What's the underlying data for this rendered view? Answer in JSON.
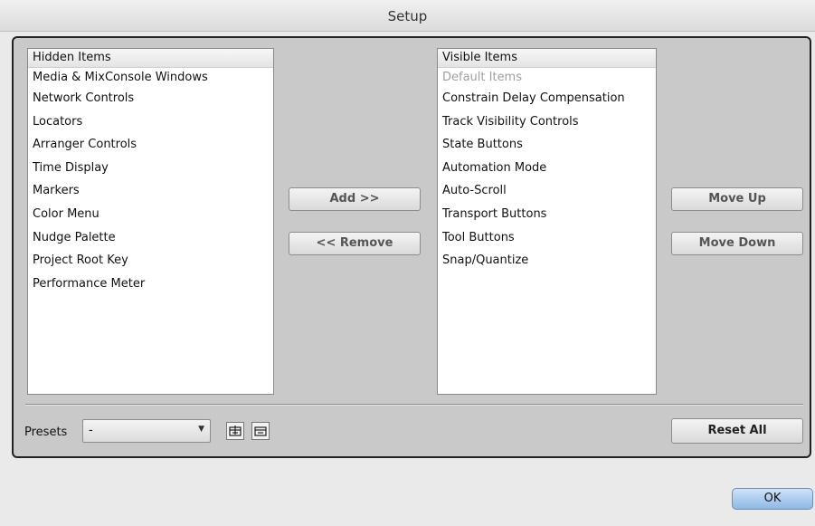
{
  "window": {
    "title": "Setup"
  },
  "hidden_list": {
    "header": "Hidden Items",
    "items": [
      "Media & MixConsole Windows",
      "Network Controls",
      "Locators",
      "Arranger Controls",
      "Time Display",
      "Markers",
      "Color Menu",
      "Nudge Palette",
      "Project Root Key",
      "Performance Meter"
    ]
  },
  "visible_list": {
    "header": "Visible Items",
    "default_item": "Default Items",
    "items": [
      "Constrain Delay Compensation",
      "Track Visibility Controls",
      "State Buttons",
      "Automation Mode",
      "Auto-Scroll",
      "Transport Buttons",
      "Tool Buttons",
      "Snap/Quantize"
    ]
  },
  "buttons": {
    "add": "Add >>",
    "remove": "<< Remove",
    "move_up": "Move Up",
    "move_down": "Move Down",
    "reset_all": "Reset All",
    "ok": "OK"
  },
  "presets": {
    "label": "Presets",
    "selected": "-"
  },
  "icons": {
    "save_preset": "save-preset-icon",
    "delete_preset": "delete-preset-icon"
  }
}
